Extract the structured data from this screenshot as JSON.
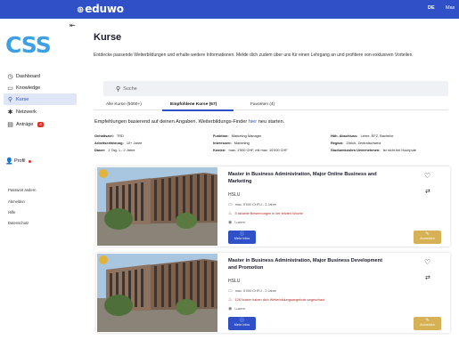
{
  "topbar": {
    "brand": "eduwo",
    "brand_mark": "⊕",
    "lang": "DE",
    "user": "Max"
  },
  "sidebar": {
    "logo": "CSS",
    "collapse_icon": "collapse-left-icon",
    "items": [
      {
        "label": "Dashboard",
        "icon": "dashboard-icon",
        "active": false
      },
      {
        "label": "Knowledge",
        "icon": "book-icon",
        "active": false
      },
      {
        "label": "Kurse",
        "icon": "search-icon",
        "active": true
      },
      {
        "label": "Netzwerk",
        "icon": "network-icon",
        "active": false
      },
      {
        "label": "Anträge",
        "icon": "clipboard-icon",
        "active": false,
        "badge": "4"
      }
    ],
    "profil": "Profil",
    "footer_links": [
      "Passwort ändern",
      "Abmelden",
      "Hilfe",
      "Datenschutz"
    ]
  },
  "main": {
    "title": "Kurse",
    "intro": "Entdecke passende Weiterbildungen und erhalte weitere Informationen. Melde dich zudem über uns für einen Lehrgang an und profitiere von exklusiven Vorteilen.",
    "search_placeholder": "Suche",
    "tabs": [
      {
        "label": "Alle Kurse (5000+)",
        "active": false
      },
      {
        "label": "Empfohlene Kurse (57)",
        "active": true
      },
      {
        "label": "Favoriten (4)",
        "active": false
      }
    ],
    "reco_pre": "Empfehlungen basierend auf deinen Angaben. Weiterbildungs-Finder ",
    "reco_link": "hier",
    "reco_post": " neu starten.",
    "filters": [
      {
        "label": "Gehaltsziel:",
        "value": "TRD"
      },
      {
        "label": "Funktion:",
        "value": "Marketing Manager"
      },
      {
        "label": "Höh. Abschluss:",
        "value": "Lehre, EFZ, Bachelor"
      },
      {
        "label": "Arbeitserfahrung:",
        "value": "10+ Jahre"
      },
      {
        "label": "Interessen:",
        "value": "Marketing"
      },
      {
        "label": "Region:",
        "value": "Zürich, Zentralschweiz"
      },
      {
        "label": "Dauer:",
        "value": "1 Tag, 1 - 2 Jahre"
      },
      {
        "label": "Kosten:",
        "value": "max. 1'500 CHF, mit max. 10'000 CHF"
      },
      {
        "label": "Studiumkosten Unternehmen:",
        "value": "Ist nicht bei Hochpute"
      }
    ]
  },
  "courses": [
    {
      "title": "Master in Business Administration, Major Online Business and Marketing",
      "institution": "HSLU",
      "cost": "max. 5'000 CHF/J - 2 Jahre",
      "hot": "5 aktuelle Bewerbungen in der letzten Woche",
      "location": "Luzern",
      "info_label": "Mehr Infos",
      "apply_label": "Anmelden"
    },
    {
      "title": "Master in Business Administration, Major Business Development and Promotion",
      "institution": "HSLU",
      "cost": "max. 5'000 CHF/J - 2 Jahre",
      "hot": "128 Nutzer haben dich Weiterbildungsangebote angeschaut",
      "location": "Luzern",
      "info_label": "Mehr Infos",
      "apply_label": "Anmelden"
    }
  ],
  "colors": {
    "primary": "#2f50c7",
    "logo": "#3ea0e4",
    "apply": "#d6b155",
    "alert": "#d9342b"
  }
}
